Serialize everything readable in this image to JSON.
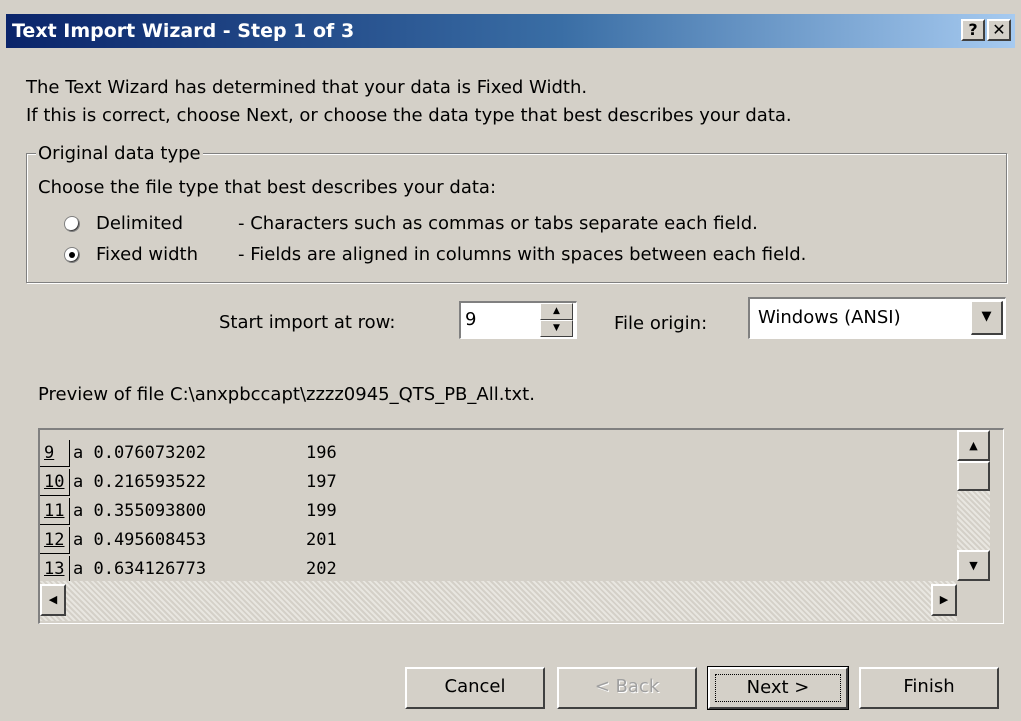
{
  "window": {
    "title": "Text Import Wizard - Step 1 of 3",
    "help_glyph": "?",
    "close_glyph": "✕"
  },
  "intro": {
    "line1": "The Text Wizard has determined that your data is Fixed Width.",
    "line2": "If this is correct, choose Next, or choose the data type that best describes your data."
  },
  "group": {
    "legend": "Original data type",
    "instruction": "Choose the file type that best describes your data:",
    "options": [
      {
        "label": "Delimited",
        "description": "- Characters such as commas or tabs separate each field.",
        "selected": false
      },
      {
        "label": "Fixed width",
        "description": "- Fields are aligned in columns with spaces between each field.",
        "selected": true
      }
    ]
  },
  "start_row": {
    "label": "Start import at row:",
    "value": "9"
  },
  "file_origin": {
    "label": "File origin:",
    "value": "Windows (ANSI)"
  },
  "preview": {
    "label": "Preview of file C:\\anxpbccapt\\zzzz0945_QTS_PB_All.txt.",
    "rows": [
      {
        "num": "9",
        "text": "a 0.076073202",
        "value": "196"
      },
      {
        "num": "10",
        "text": "a 0.216593522",
        "value": "197"
      },
      {
        "num": "11",
        "text": "a 0.355093800",
        "value": "199"
      },
      {
        "num": "12",
        "text": "a 0.495608453",
        "value": "201"
      },
      {
        "num": "13",
        "text": "a 0.634126773",
        "value": "202"
      }
    ]
  },
  "buttons": {
    "cancel": "Cancel",
    "back": "< Back",
    "next": "Next >",
    "finish": "Finish"
  }
}
